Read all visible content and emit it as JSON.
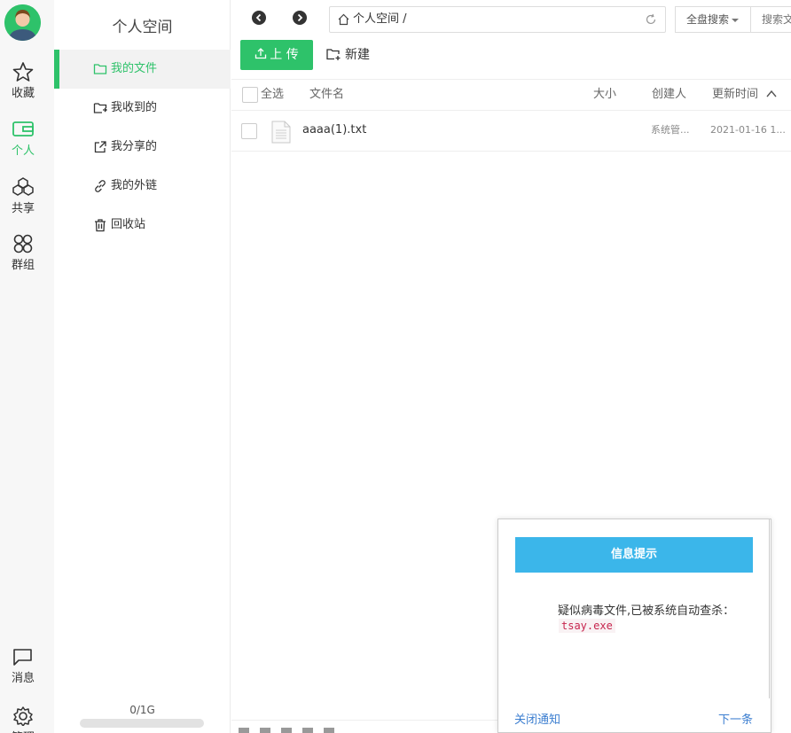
{
  "rail": {
    "items": [
      {
        "label": "收藏",
        "icon": "star-icon"
      },
      {
        "label": "个人",
        "icon": "wallet-icon"
      },
      {
        "label": "共享",
        "icon": "cubes-icon"
      },
      {
        "label": "群组",
        "icon": "group-icon"
      },
      {
        "label": "消息",
        "icon": "megaphone-icon"
      },
      {
        "label": "管理",
        "icon": "gear-icon"
      }
    ]
  },
  "subnav": {
    "title": "个人空间",
    "items": [
      {
        "label": "我的文件",
        "icon": "folder-icon"
      },
      {
        "label": "我收到的",
        "icon": "folder-receive-icon"
      },
      {
        "label": "我分享的",
        "icon": "share-icon"
      },
      {
        "label": "我的外链",
        "icon": "link-icon"
      },
      {
        "label": "回收站",
        "icon": "trash-icon"
      }
    ],
    "quota": {
      "text": "0/1G",
      "used_fraction": 0
    }
  },
  "toolbar": {
    "path": "个人空间 /",
    "scope": "全盘搜索",
    "search_placeholder": "搜索文",
    "upload_label": "上 传",
    "new_label": "新建"
  },
  "table": {
    "headers": {
      "select_all": "全选",
      "name": "文件名",
      "size": "大小",
      "creator": "创建人",
      "updated": "更新时间"
    },
    "rows": [
      {
        "name": "aaaa(1).txt",
        "size": "",
        "creator": "系统管...",
        "updated": "2021-01-16 1..."
      }
    ]
  },
  "notice": {
    "title": "信息提示",
    "message": "疑似病毒文件,已被系统自动查杀：",
    "filename": "tsay.exe",
    "close_label": "关闭通知",
    "next_label": "下一条"
  },
  "colors": {
    "accent": "#2ec26a",
    "notice_header": "#3bb6ea",
    "link": "#3b7ed0"
  }
}
